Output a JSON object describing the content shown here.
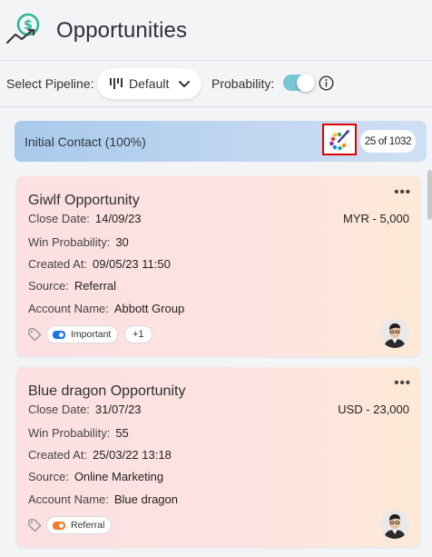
{
  "header": {
    "title": "Opportunities"
  },
  "toolbar": {
    "pipeline_label": "Select Pipeline:",
    "pipeline_value": "Default",
    "probability_label": "Probability:",
    "probability_on": true
  },
  "stage": {
    "title": "Initial Contact (100%)",
    "count": "25 of 1032"
  },
  "cards": [
    {
      "title": "Giwlf Opportunity",
      "close_date_label": "Close Date:",
      "close_date": "14/09/23",
      "amount": "MYR - 5,000",
      "win_prob_label": "Win Probability:",
      "win_prob": "30",
      "created_label": "Created At:",
      "created": "09/05/23 11:50",
      "source_label": "Source:",
      "source": "Referral",
      "account_label": "Account Name:",
      "account": "Abbott Group",
      "tag": "Important",
      "tag_color": "#1a73e8",
      "extra_tags": "+1"
    },
    {
      "title": "Blue dragon Opportunity",
      "close_date_label": "Close Date:",
      "close_date": "31/07/23",
      "amount": "USD - 23,000",
      "win_prob_label": "Win Probability:",
      "win_prob": "55",
      "created_label": "Created At:",
      "created": "25/03/22 13:18",
      "source_label": "Source:",
      "source": "Online Marketing",
      "account_label": "Account Name:",
      "account": "Blue dragon",
      "tag": "Referral",
      "tag_color": "#f27b2e"
    }
  ],
  "colors": {
    "accent_teal": "#79c7d2",
    "highlight_red": "#e00000",
    "logo_green": "#2fb59c"
  },
  "icons": [
    "dollar-trend-logo-icon",
    "pipeline-icon",
    "chevron-down-icon",
    "info-icon",
    "color-palette-icon",
    "more-dots-icon",
    "tag-icon",
    "avatar"
  ]
}
